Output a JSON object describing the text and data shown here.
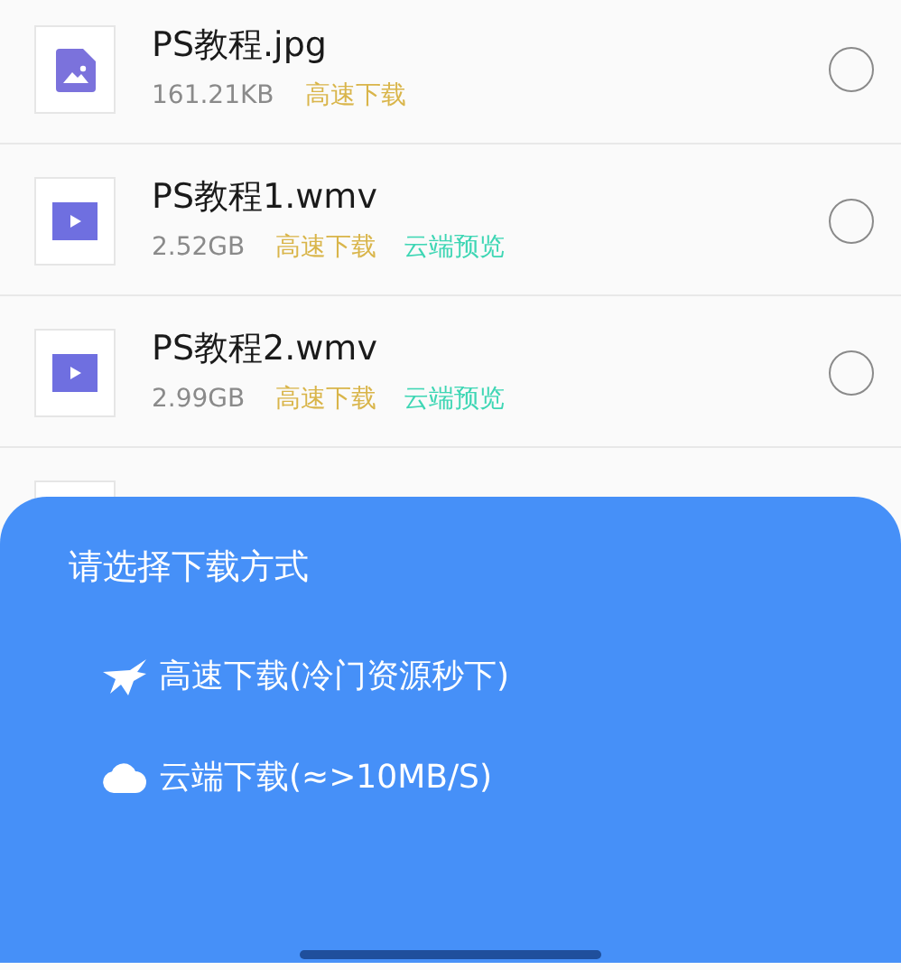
{
  "files": [
    {
      "name": "PS教程.jpg",
      "kind": "image",
      "size": "161.21KB",
      "tags": [
        {
          "label": "高速下载",
          "color": "#d9b54a"
        }
      ],
      "selected": false
    },
    {
      "name": "PS教程1.wmv",
      "kind": "video",
      "size": "2.52GB",
      "tags": [
        {
          "label": "高速下载",
          "color": "#d9b54a"
        },
        {
          "label": "云端预览",
          "color": "#3ed6b4"
        }
      ],
      "selected": false
    },
    {
      "name": "PS教程2.wmv",
      "kind": "video",
      "size": "2.99GB",
      "tags": [
        {
          "label": "高速下载",
          "color": "#d9b54a"
        },
        {
          "label": "云端预览",
          "color": "#3ed6b4"
        }
      ],
      "selected": false
    }
  ],
  "sheet": {
    "title": "请选择下载方式",
    "options": [
      {
        "kind": "swift",
        "label": "高速下载(冷门资源秒下)"
      },
      {
        "kind": "cloud",
        "label": "云端下载(≈>10MB/S)"
      }
    ]
  }
}
